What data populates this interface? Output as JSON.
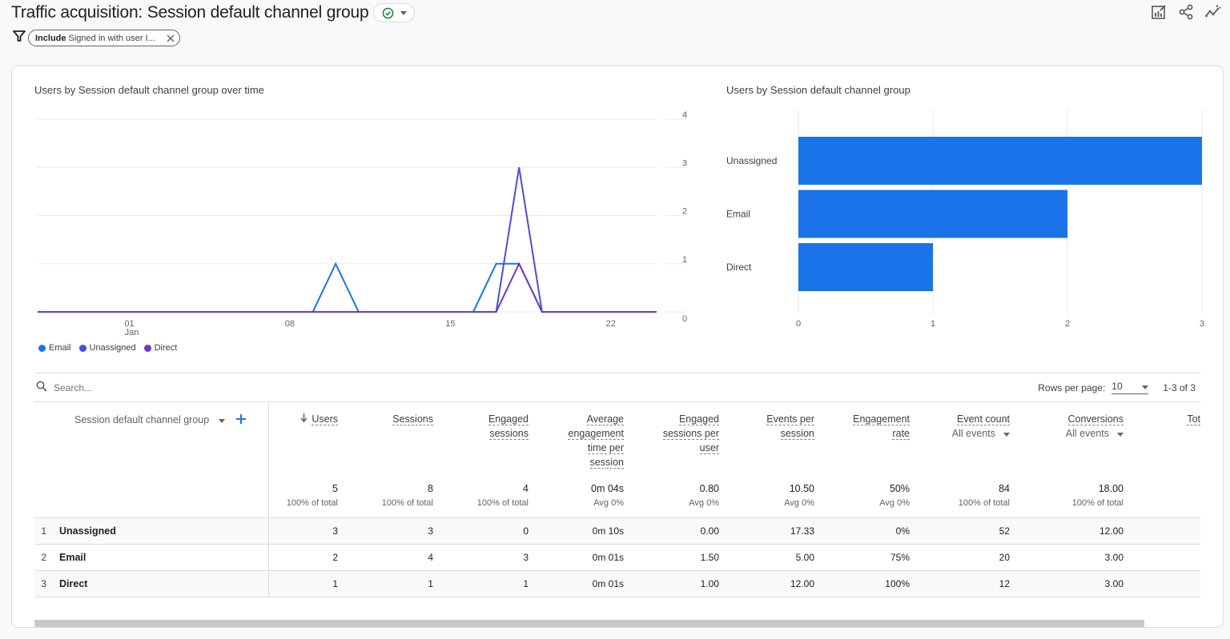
{
  "header": {
    "title": "Traffic acquisition: Session default channel group",
    "status_icon": "check-circle-icon",
    "top_icons": [
      "customize-report-icon",
      "share-icon",
      "insights-icon"
    ]
  },
  "filter": {
    "icon": "filter-icon",
    "chip_bold": "Include",
    "chip_text": "Signed in with user I...",
    "close_icon": "close-icon"
  },
  "colors": {
    "email": "#1a73e8",
    "unassigned": "#4b4ce0",
    "direct": "#7237c7",
    "bar": "#1a73e8"
  },
  "chart_data": [
    {
      "type": "line",
      "title": "Users by Session default channel group over time",
      "x": [
        "Dec 28",
        "Dec 29",
        "Dec 30",
        "Dec 31",
        "Jan 01",
        "Jan 02",
        "Jan 03",
        "Jan 04",
        "Jan 05",
        "Jan 06",
        "Jan 07",
        "Jan 08",
        "Jan 09",
        "Jan 10",
        "Jan 11",
        "Jan 12",
        "Jan 13",
        "Jan 14",
        "Jan 15",
        "Jan 16",
        "Jan 17",
        "Jan 18",
        "Jan 19",
        "Jan 20",
        "Jan 21",
        "Jan 22",
        "Jan 23",
        "Jan 24"
      ],
      "x_tick_labels": [
        {
          "index": 4,
          "label": "01",
          "sublabel": "Jan"
        },
        {
          "index": 11,
          "label": "08",
          "sublabel": ""
        },
        {
          "index": 18,
          "label": "15",
          "sublabel": ""
        },
        {
          "index": 25,
          "label": "22",
          "sublabel": ""
        }
      ],
      "series": [
        {
          "name": "Email",
          "values": [
            0,
            0,
            0,
            0,
            0,
            0,
            0,
            0,
            0,
            0,
            0,
            0,
            0,
            1,
            0,
            0,
            0,
            0,
            0,
            0,
            1,
            1,
            0,
            0,
            0,
            0,
            0,
            0
          ]
        },
        {
          "name": "Unassigned",
          "values": [
            0,
            0,
            0,
            0,
            0,
            0,
            0,
            0,
            0,
            0,
            0,
            0,
            0,
            0,
            0,
            0,
            0,
            0,
            0,
            0,
            0,
            3,
            0,
            0,
            0,
            0,
            0,
            0
          ]
        },
        {
          "name": "Direct",
          "values": [
            0,
            0,
            0,
            0,
            0,
            0,
            0,
            0,
            0,
            0,
            0,
            0,
            0,
            0,
            0,
            0,
            0,
            0,
            0,
            0,
            0,
            1,
            0,
            0,
            0,
            0,
            0,
            0
          ]
        }
      ],
      "y_ticks": [
        0,
        1,
        2,
        3,
        4
      ],
      "ylim": [
        0,
        4
      ],
      "y_axis_side": "right",
      "grid": true,
      "legend": [
        "Email",
        "Unassigned",
        "Direct"
      ],
      "legend_position": "bottom-left"
    },
    {
      "type": "bar",
      "orientation": "horizontal",
      "title": "Users by Session default channel group",
      "categories": [
        "Unassigned",
        "Email",
        "Direct"
      ],
      "values": [
        3,
        2,
        1
      ],
      "x_ticks": [
        0,
        1,
        2,
        3
      ],
      "xlim": [
        0,
        3
      ],
      "grid": true
    }
  ],
  "table": {
    "search_placeholder": "Search...",
    "rows_per_page_label": "Rows per page:",
    "rows_per_page_value": "10",
    "pagination": "1-3 of 3",
    "dimension_header": "Session default channel group",
    "columns": [
      {
        "label_lines": [
          "Users"
        ],
        "sorted": true,
        "total": "5",
        "total_sub": "100% of total"
      },
      {
        "label_lines": [
          "Sessions"
        ],
        "total": "8",
        "total_sub": "100% of total"
      },
      {
        "label_lines": [
          "Engaged",
          "sessions"
        ],
        "total": "4",
        "total_sub": "100% of total"
      },
      {
        "label_lines": [
          "Average",
          "engagement",
          "time per",
          "session"
        ],
        "total": "0m 04s",
        "total_sub": "Avg 0%"
      },
      {
        "label_lines": [
          "Engaged",
          "sessions per",
          "user"
        ],
        "total": "0.80",
        "total_sub": "Avg 0%"
      },
      {
        "label_lines": [
          "Events per",
          "session"
        ],
        "total": "10.50",
        "total_sub": "Avg 0%"
      },
      {
        "label_lines": [
          "Engagement",
          "rate"
        ],
        "total": "50%",
        "total_sub": "Avg 0%"
      },
      {
        "label_lines": [
          "Event count"
        ],
        "selector": "All events",
        "total": "84",
        "total_sub": "100% of total"
      },
      {
        "label_lines": [
          "Conversions"
        ],
        "selector": "All events",
        "total": "18.00",
        "total_sub": "100% of total"
      },
      {
        "label_lines": [
          "Tot"
        ],
        "total": "",
        "total_sub": ""
      }
    ],
    "rows": [
      {
        "index": "1",
        "dimension": "Unassigned",
        "values": [
          "3",
          "3",
          "0",
          "0m 10s",
          "0.00",
          "17.33",
          "0%",
          "52",
          "12.00",
          ""
        ]
      },
      {
        "index": "2",
        "dimension": "Email",
        "values": [
          "2",
          "4",
          "3",
          "0m 01s",
          "1.50",
          "5.00",
          "75%",
          "20",
          "3.00",
          ""
        ]
      },
      {
        "index": "3",
        "dimension": "Direct",
        "values": [
          "1",
          "1",
          "1",
          "0m 01s",
          "1.00",
          "12.00",
          "100%",
          "12",
          "3.00",
          ""
        ]
      }
    ]
  }
}
